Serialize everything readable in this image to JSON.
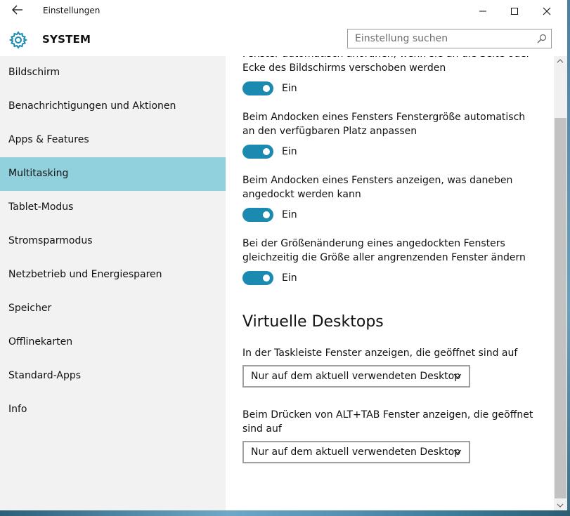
{
  "window": {
    "title": "Einstellungen"
  },
  "header": {
    "title": "SYSTEM",
    "search_placeholder": "Einstellung suchen"
  },
  "sidebar": {
    "items": [
      {
        "label": "Bildschirm"
      },
      {
        "label": "Benachrichtigungen und Aktionen"
      },
      {
        "label": "Apps & Features"
      },
      {
        "label": "Multitasking"
      },
      {
        "label": "Tablet-Modus"
      },
      {
        "label": "Stromsparmodus"
      },
      {
        "label": "Netzbetrieb und Energiesparen"
      },
      {
        "label": "Speicher"
      },
      {
        "label": "Offlinekarten"
      },
      {
        "label": "Standard-Apps"
      },
      {
        "label": "Info"
      }
    ],
    "active": "Multitasking"
  },
  "content": {
    "settings": [
      {
        "description": "Fenster automatisch anordnen, wenn sie an die Seite oder Ecke des Bildschirms verschoben werden",
        "state": "Ein"
      },
      {
        "description": "Beim Andocken eines Fensters Fenstergröße automatisch an den verfügbaren Platz anpassen",
        "state": "Ein"
      },
      {
        "description": "Beim Andocken eines Fensters anzeigen, was daneben angedockt werden kann",
        "state": "Ein"
      },
      {
        "description": "Bei der Größenänderung eines angedockten Fensters gleichzeitig die Größe aller angrenzenden Fenster ändern",
        "state": "Ein"
      }
    ],
    "virtual_desktops": {
      "title": "Virtuelle Desktops",
      "taskbar_label": "In der Taskleiste Fenster anzeigen, die geöffnet sind auf",
      "taskbar_value": "Nur auf dem aktuell verwendeten Desktop",
      "alttab_label": "Beim Drücken von ALT+TAB Fenster anzeigen, die geöffnet sind auf",
      "alttab_value": "Nur auf dem aktuell verwendeten Desktop"
    }
  },
  "colors": {
    "accent": "#1a8ab0",
    "active_nav": "#91d1de",
    "sidebar_bg": "#f2f2f2"
  }
}
